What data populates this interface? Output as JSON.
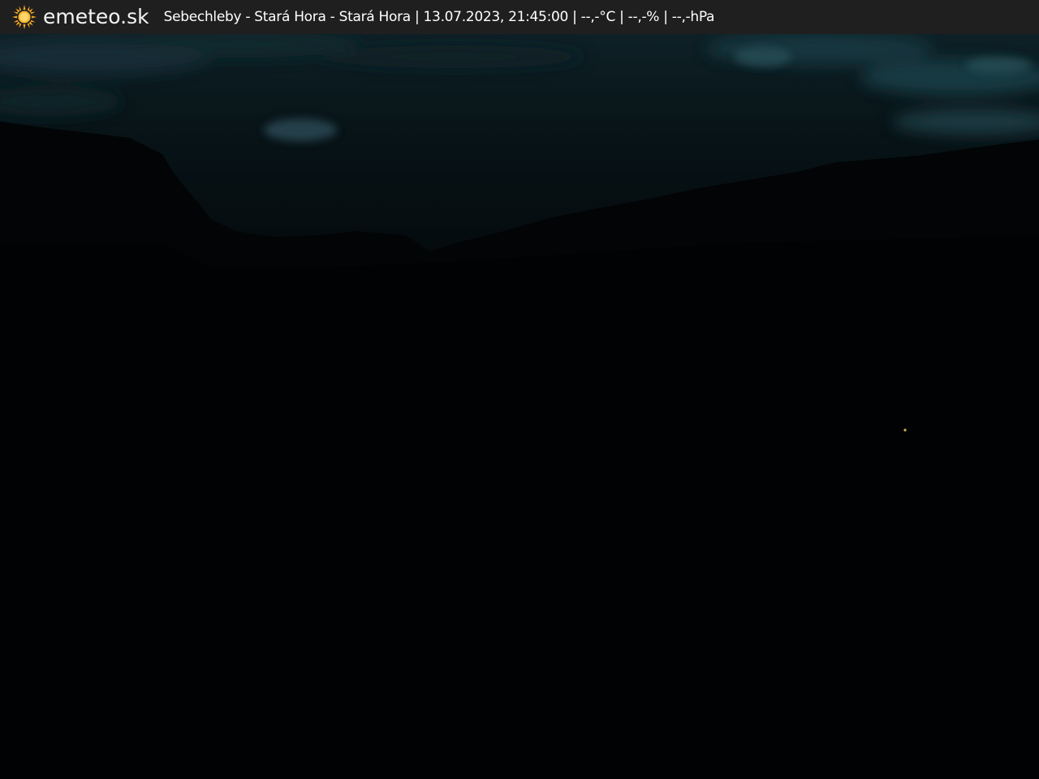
{
  "header": {
    "logo_icon": "sun-icon",
    "brand": "emeteo.sk",
    "caption": "Sebechleby - Stará Hora - Stará Hora | 13.07.2023, 21:45:00 | --,-°C | --,-% | --,-hPa"
  },
  "colors": {
    "bar_background": "#1f1f1f",
    "sun": "#f5a623",
    "sky_cloud": "#1c3e47",
    "night_ground": "#010203"
  }
}
